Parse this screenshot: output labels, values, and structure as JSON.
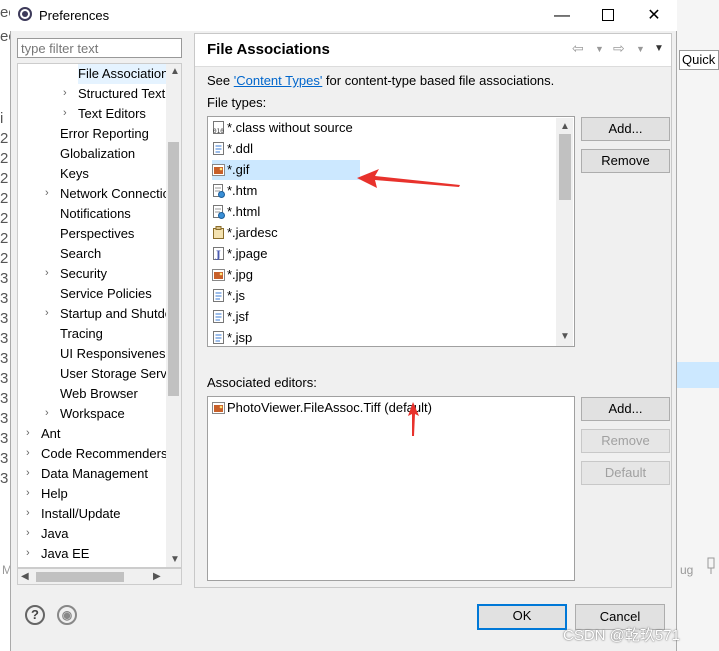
{
  "background": {
    "left_chars": [
      "ecl",
      "ec",
      "i",
      "2",
      "2",
      "2",
      "2",
      "2",
      "2",
      "2",
      "3",
      "3",
      "3",
      "3",
      "3",
      "3",
      "3",
      "3",
      "3",
      "3",
      "3"
    ],
    "quick_access": "Quick A",
    "ug_text": "ug",
    "m_text": "M"
  },
  "window": {
    "title": "Preferences",
    "minimize": "—",
    "maximize": "☐",
    "close": "✕"
  },
  "filter": {
    "placeholder": "type filter text"
  },
  "tree": {
    "items": [
      {
        "label": "File Associations",
        "indent": 3,
        "arrow": "",
        "selected": true
      },
      {
        "label": "Structured Text Editors",
        "indent": 3,
        "arrow": "›"
      },
      {
        "label": "Text Editors",
        "indent": 3,
        "arrow": "›"
      },
      {
        "label": "Error Reporting",
        "indent": 2,
        "arrow": ""
      },
      {
        "label": "Globalization",
        "indent": 2,
        "arrow": ""
      },
      {
        "label": "Keys",
        "indent": 2,
        "arrow": ""
      },
      {
        "label": "Network Connections",
        "indent": 2,
        "arrow": "›"
      },
      {
        "label": "Notifications",
        "indent": 2,
        "arrow": ""
      },
      {
        "label": "Perspectives",
        "indent": 2,
        "arrow": ""
      },
      {
        "label": "Search",
        "indent": 2,
        "arrow": ""
      },
      {
        "label": "Security",
        "indent": 2,
        "arrow": "›"
      },
      {
        "label": "Service Policies",
        "indent": 2,
        "arrow": ""
      },
      {
        "label": "Startup and Shutdown",
        "indent": 2,
        "arrow": "›"
      },
      {
        "label": "Tracing",
        "indent": 2,
        "arrow": ""
      },
      {
        "label": "UI Responsiveness",
        "indent": 2,
        "arrow": ""
      },
      {
        "label": "User Storage Service",
        "indent": 2,
        "arrow": ""
      },
      {
        "label": "Web Browser",
        "indent": 2,
        "arrow": ""
      },
      {
        "label": "Workspace",
        "indent": 2,
        "arrow": "›"
      },
      {
        "label": "Ant",
        "indent": 1,
        "arrow": "›"
      },
      {
        "label": "Code Recommenders",
        "indent": 1,
        "arrow": "›"
      },
      {
        "label": "Data Management",
        "indent": 1,
        "arrow": "›"
      },
      {
        "label": "Help",
        "indent": 1,
        "arrow": "›"
      },
      {
        "label": "Install/Update",
        "indent": 1,
        "arrow": "›"
      },
      {
        "label": "Java",
        "indent": 1,
        "arrow": "›"
      },
      {
        "label": "Java EE",
        "indent": 1,
        "arrow": "›"
      }
    ]
  },
  "page": {
    "title": "File Associations",
    "see_prefix": "See ",
    "see_link": "'Content Types'",
    "see_suffix": " for content-type based file associations.",
    "file_types_label": "File types:",
    "file_types": [
      {
        "name": "*.class without source",
        "icon": "class"
      },
      {
        "name": "*.ddl",
        "icon": "doc"
      },
      {
        "name": "*.gif",
        "icon": "image",
        "selected": true
      },
      {
        "name": "*.htm",
        "icon": "web"
      },
      {
        "name": "*.html",
        "icon": "web"
      },
      {
        "name": "*.jardesc",
        "icon": "jar"
      },
      {
        "name": "*.jpage",
        "icon": "java"
      },
      {
        "name": "*.jpg",
        "icon": "image"
      },
      {
        "name": "*.js",
        "icon": "doc"
      },
      {
        "name": "*.jsf",
        "icon": "doc"
      },
      {
        "name": "*.jsp",
        "icon": "doc"
      }
    ],
    "add_label": "Add...",
    "remove_label": "Remove",
    "associated_label": "Associated editors:",
    "editors": [
      {
        "name": "PhotoViewer.FileAssoc.Tiff (default)",
        "icon": "image"
      }
    ],
    "editor_add_label": "Add...",
    "editor_remove_label": "Remove",
    "editor_default_label": "Default"
  },
  "footer": {
    "help_symbol": "?",
    "prefs_symbol": "◉",
    "ok_label": "OK",
    "cancel_label": "Cancel"
  },
  "colors": {
    "accent": "#0078d7",
    "selection": "#cce8ff",
    "annotation": "#e8322c"
  },
  "watermark": "CSDN @乾玖571"
}
